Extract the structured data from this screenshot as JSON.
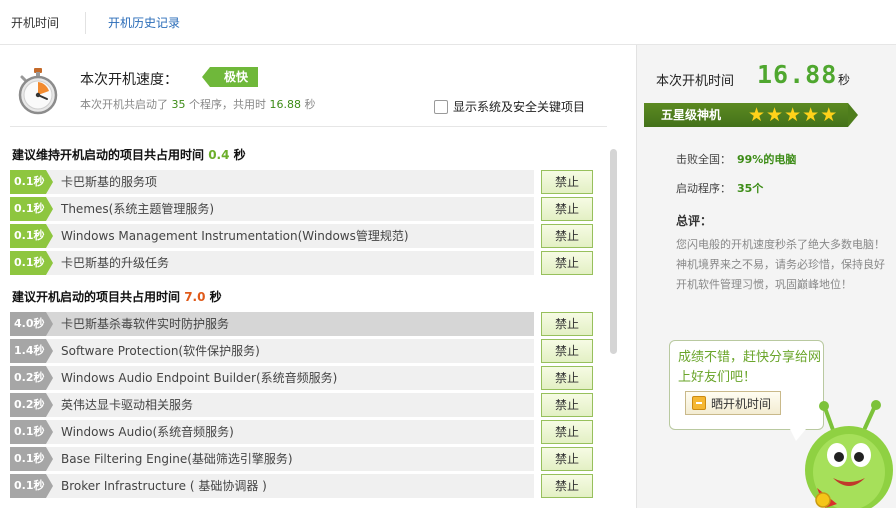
{
  "tabs": [
    {
      "label": "开机时间"
    },
    {
      "label": "开机历史记录"
    }
  ],
  "speed": {
    "title": "本次开机速度：",
    "badge": "极快",
    "sub_prefix": "本次开机共启动了",
    "program_count": "35",
    "sub_mid": "个程序，共用时",
    "time": "16.88",
    "time_unit": "秒",
    "show_system_label": "显示系统及安全关键项目",
    "show_system_checked": false
  },
  "section_keep": {
    "prefix": "建议维持开机启动的项目共占用时间",
    "value": "0.4",
    "unit": "秒",
    "items": [
      {
        "time": "0.1秒",
        "name": "卡巴斯基的服务项",
        "action": "禁止"
      },
      {
        "time": "0.1秒",
        "name": "Themes(系统主题管理服务)",
        "action": "禁止"
      },
      {
        "time": "0.1秒",
        "name": "Windows Management Instrumentation(Windows管理规范)",
        "action": "禁止"
      },
      {
        "time": "0.1秒",
        "name": "卡巴斯基的升级任务",
        "action": "禁止"
      }
    ]
  },
  "section_startup": {
    "prefix": "建议开机启动的项目共占用时间",
    "value": "7.0",
    "unit": "秒",
    "items": [
      {
        "time": "4.0秒",
        "name": "卡巴斯基杀毒软件实时防护服务",
        "action": "禁止"
      },
      {
        "time": "1.4秒",
        "name": "Software Protection(软件保护服务)",
        "action": "禁止"
      },
      {
        "time": "0.2秒",
        "name": "Windows Audio Endpoint Builder(系统音频服务)",
        "action": "禁止"
      },
      {
        "time": "0.2秒",
        "name": "英伟达显卡驱动相关服务",
        "action": "禁止"
      },
      {
        "time": "0.1秒",
        "name": "Windows Audio(系统音频服务)",
        "action": "禁止"
      },
      {
        "time": "0.1秒",
        "name": "Base Filtering Engine(基础筛选引擎服务)",
        "action": "禁止"
      },
      {
        "time": "0.1秒",
        "name": "Broker Infrastructure ( 基础协调器 )",
        "action": "禁止"
      }
    ]
  },
  "summary_panel": {
    "time_label": "本次开机时间",
    "time_value": "16.88",
    "time_unit": "秒",
    "rank_label": "五星级神机",
    "stars": 5,
    "beat_label": "击败全国：",
    "beat_value": "99%的电脑",
    "programs_label": "启动程序：",
    "programs_value": "35个",
    "comment_title": "总评：",
    "comment_text": "您闪电般的开机速度秒杀了绝大多数电脑！神机境界来之不易，请务必珍惜，保持良好开机软件管理习惯，巩固巅峰地位！",
    "share_prompt": "成绩不错，赶快分享给网上好友们吧！",
    "share_button": "晒开机时间"
  },
  "colors": {
    "accent_green": "#6cae2a",
    "warn_red": "#e05a1a",
    "link_blue": "#2a6cb8"
  }
}
